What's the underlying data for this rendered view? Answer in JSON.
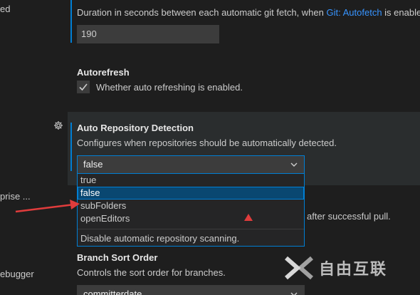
{
  "sidebar": {
    "items": [
      {
        "label": "ed"
      },
      {
        "label": "prise ..."
      },
      {
        "label": "ebugger"
      }
    ]
  },
  "settings": {
    "autofetch_period": {
      "description_before": "Duration in seconds between each automatic git fetch, when ",
      "link": "Git: Autofetch",
      "description_after": " is enable",
      "value": "190"
    },
    "autorefresh": {
      "title": "Autorefresh",
      "description": "Whether auto refreshing is enabled.",
      "checked": true
    },
    "auto_repository_detection": {
      "title": "Auto Repository Detection",
      "description": "Configures when repositories should be automatically detected.",
      "selected_value": "false",
      "options": [
        {
          "label": "true",
          "selected": false
        },
        {
          "label": "false",
          "selected": true
        },
        {
          "label": "subFolders",
          "selected": false
        },
        {
          "label": "openEditors",
          "selected": false
        }
      ],
      "option_description": "Disable automatic repository scanning."
    },
    "behind_setting": {
      "description_partial": "after successful pull."
    },
    "branch_sort_order": {
      "title": "Branch Sort Order",
      "description": "Controls the sort order for branches.",
      "value": "committerdate"
    }
  },
  "annotations": {
    "arrow_color": "#e03c3c",
    "marker_color": "#e03c3c"
  },
  "watermark": {
    "text": "自由互联"
  },
  "colors": {
    "background": "#1e1e1e",
    "accent": "#007fd4",
    "link": "#3794ff",
    "selected_option_bg": "#094771"
  },
  "icons": {
    "settings_gear": "gear-icon",
    "checkmark": "check-icon",
    "chevron": "chevron-down-icon"
  }
}
